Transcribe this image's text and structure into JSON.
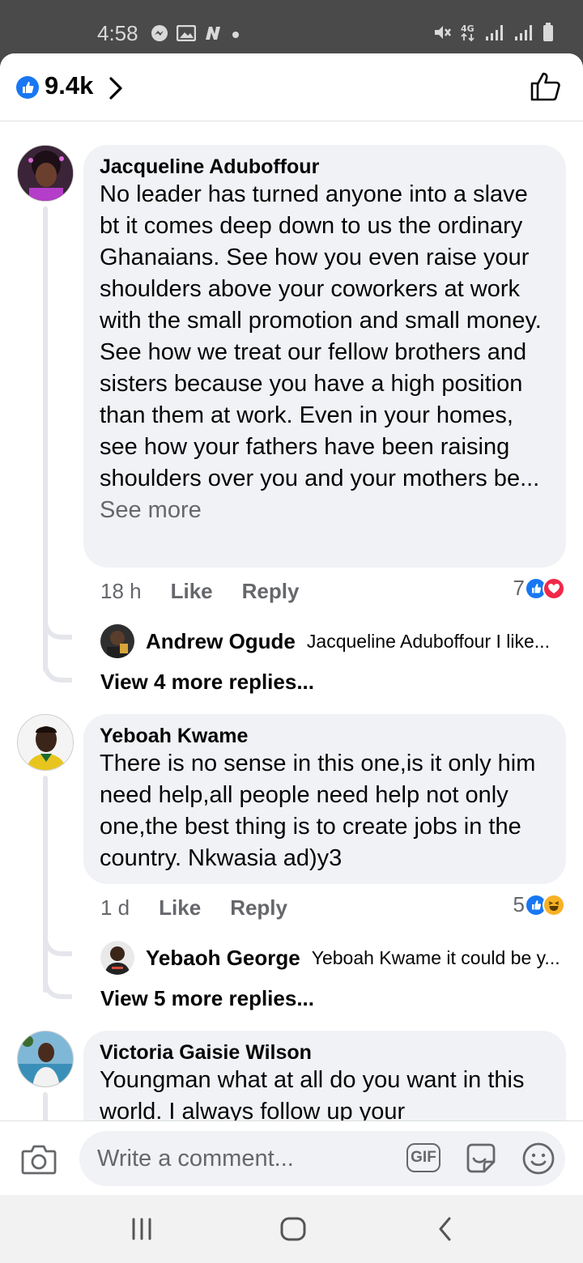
{
  "status_bar": {
    "time": "4:58",
    "left_icons": [
      "messenger-icon",
      "gallery-icon",
      "n-app-icon",
      "dot-icon"
    ],
    "right_icons": [
      "mute-icon",
      "4g-icon",
      "signal-icon",
      "signal-icon",
      "battery-icon"
    ]
  },
  "header": {
    "like_count": "9.4k"
  },
  "comments": [
    {
      "author": "Jacqueline Aduboffour",
      "text": "No leader has turned anyone into a slave bt it comes deep down to us the ordinary Ghanaians. See how you even raise your shoulders above your coworkers at work with the small promotion and small money. See how we treat our fellow brothers and sisters because you have a high position than them at work. Even in your homes, see how your fathers have been raising shoulders over you and your mothers be...",
      "see_more": "See more",
      "time": "18 h",
      "like_label": "Like",
      "reply_label": "Reply",
      "reaction_count": "7",
      "reactions": [
        "like",
        "love"
      ],
      "reply_preview": {
        "author": "Andrew Ogude",
        "text": "Jacqueline Aduboffour I like..."
      },
      "view_more": "View 4 more replies..."
    },
    {
      "author": "Yeboah Kwame",
      "text": "There is no sense in this one,is it only him need help,all people need help not only one,the best thing is to create jobs in the country. Nkwasia ad)y3",
      "time": "1 d",
      "like_label": "Like",
      "reply_label": "Reply",
      "reaction_count": "5",
      "reactions": [
        "like",
        "haha"
      ],
      "reply_preview": {
        "author": "Yebaoh George",
        "text": "Yeboah Kwame it could be y..."
      },
      "view_more": "View 5 more replies..."
    },
    {
      "author": "Victoria Gaisie Wilson",
      "text": "Youngman what at all do you want in this world. I always follow up your"
    }
  ],
  "composer": {
    "placeholder": "Write a comment...",
    "gif_label": "GIF"
  },
  "colors": {
    "accent": "#1877f2",
    "bubble": "#f0f2f5",
    "secondary_text": "#65676b",
    "love": "#f02849",
    "haha": "#f7b125"
  }
}
